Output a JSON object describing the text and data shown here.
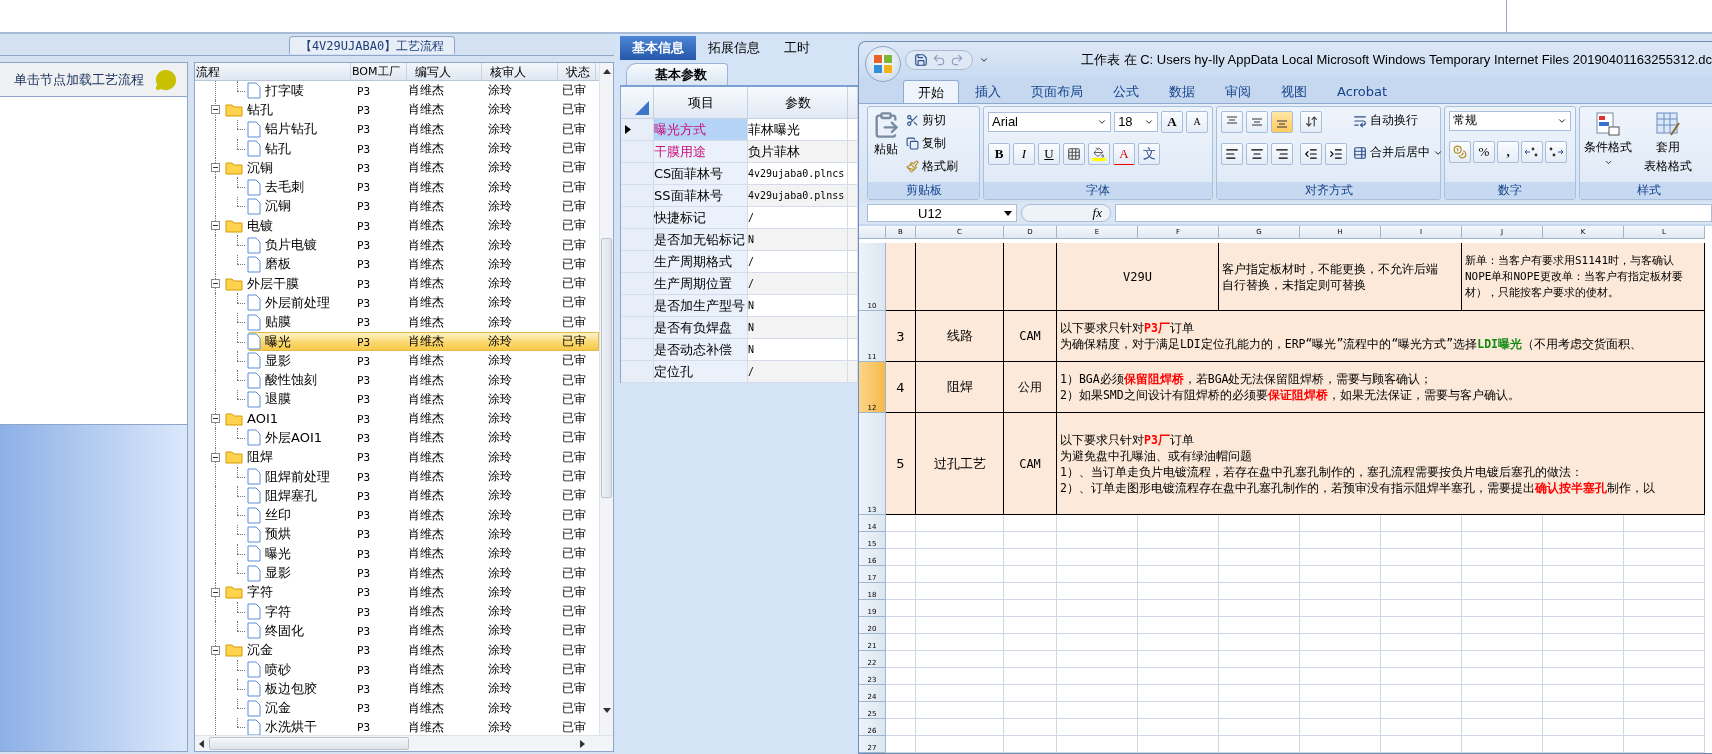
{
  "process_panel": {
    "title": "【4V29UJABA0】工艺流程",
    "hint": "单击节点加载工艺流程"
  },
  "tree": {
    "columns": [
      "流程",
      "BOM工厂",
      "编写人",
      "核审人",
      "状态"
    ],
    "nodes": [
      {
        "kind": "step",
        "name": "打字唛",
        "bom": "P3",
        "writer": "肖维杰",
        "reviewer": "涂玲",
        "status": "已审",
        "selected": false
      },
      {
        "kind": "group",
        "name": "钻孔",
        "bom": "P3",
        "writer": "肖维杰",
        "reviewer": "涂玲",
        "status": "已审",
        "selected": false,
        "expanded": true,
        "children": [
          {
            "kind": "step",
            "name": "铝片钻孔",
            "bom": "P3",
            "writer": "肖维杰",
            "reviewer": "涂玲",
            "status": "已审",
            "selected": false
          },
          {
            "kind": "step",
            "name": "钻孔",
            "bom": "P3",
            "writer": "肖维杰",
            "reviewer": "涂玲",
            "status": "已审",
            "selected": false
          }
        ]
      },
      {
        "kind": "group",
        "name": "沉铜",
        "bom": "P3",
        "writer": "肖维杰",
        "reviewer": "涂玲",
        "status": "已审",
        "selected": false,
        "expanded": true,
        "children": [
          {
            "kind": "step",
            "name": "去毛刺",
            "bom": "P3",
            "writer": "肖维杰",
            "reviewer": "涂玲",
            "status": "已审",
            "selected": false
          },
          {
            "kind": "step",
            "name": "沉铜",
            "bom": "P3",
            "writer": "肖维杰",
            "reviewer": "涂玲",
            "status": "已审",
            "selected": false
          }
        ]
      },
      {
        "kind": "group",
        "name": "电镀",
        "bom": "P3",
        "writer": "肖维杰",
        "reviewer": "涂玲",
        "status": "已审",
        "selected": false,
        "expanded": true,
        "children": [
          {
            "kind": "step",
            "name": "负片电镀",
            "bom": "P3",
            "writer": "肖维杰",
            "reviewer": "涂玲",
            "status": "已审",
            "selected": false
          },
          {
            "kind": "step",
            "name": "磨板",
            "bom": "P3",
            "writer": "肖维杰",
            "reviewer": "涂玲",
            "status": "已审",
            "selected": false
          }
        ]
      },
      {
        "kind": "group",
        "name": "外层干膜",
        "bom": "P3",
        "writer": "肖维杰",
        "reviewer": "涂玲",
        "status": "已审",
        "selected": false,
        "expanded": true,
        "children": [
          {
            "kind": "step",
            "name": "外层前处理",
            "bom": "P3",
            "writer": "肖维杰",
            "reviewer": "涂玲",
            "status": "已审",
            "selected": false
          },
          {
            "kind": "step",
            "name": "贴膜",
            "bom": "P3",
            "writer": "肖维杰",
            "reviewer": "涂玲",
            "status": "已审",
            "selected": false
          },
          {
            "kind": "step",
            "name": "曝光",
            "bom": "P3",
            "writer": "肖维杰",
            "reviewer": "涂玲",
            "status": "已审",
            "selected": true
          },
          {
            "kind": "step",
            "name": "显影",
            "bom": "P3",
            "writer": "肖维杰",
            "reviewer": "涂玲",
            "status": "已审",
            "selected": false
          },
          {
            "kind": "step",
            "name": "酸性蚀刻",
            "bom": "P3",
            "writer": "肖维杰",
            "reviewer": "涂玲",
            "status": "已审",
            "selected": false
          },
          {
            "kind": "step",
            "name": "退膜",
            "bom": "P3",
            "writer": "肖维杰",
            "reviewer": "涂玲",
            "status": "已审",
            "selected": false
          }
        ]
      },
      {
        "kind": "group",
        "name": "AOI1",
        "bom": "P3",
        "writer": "肖维杰",
        "reviewer": "涂玲",
        "status": "已审",
        "selected": false,
        "expanded": true,
        "children": [
          {
            "kind": "step",
            "name": "外层AOI1",
            "bom": "P3",
            "writer": "肖维杰",
            "reviewer": "涂玲",
            "status": "已审",
            "selected": false
          }
        ]
      },
      {
        "kind": "group",
        "name": "阻焊",
        "bom": "P3",
        "writer": "肖维杰",
        "reviewer": "涂玲",
        "status": "已审",
        "selected": false,
        "expanded": true,
        "children": [
          {
            "kind": "step",
            "name": "阻焊前处理",
            "bom": "P3",
            "writer": "肖维杰",
            "reviewer": "涂玲",
            "status": "已审",
            "selected": false
          },
          {
            "kind": "step",
            "name": "阻焊塞孔",
            "bom": "P3",
            "writer": "肖维杰",
            "reviewer": "涂玲",
            "status": "已审",
            "selected": false
          },
          {
            "kind": "step",
            "name": "丝印",
            "bom": "P3",
            "writer": "肖维杰",
            "reviewer": "涂玲",
            "status": "已审",
            "selected": false
          },
          {
            "kind": "step",
            "name": "预烘",
            "bom": "P3",
            "writer": "肖维杰",
            "reviewer": "涂玲",
            "status": "已审",
            "selected": false
          },
          {
            "kind": "step",
            "name": "曝光",
            "bom": "P3",
            "writer": "肖维杰",
            "reviewer": "涂玲",
            "status": "已审",
            "selected": false
          },
          {
            "kind": "step",
            "name": "显影",
            "bom": "P3",
            "writer": "肖维杰",
            "reviewer": "涂玲",
            "status": "已审",
            "selected": false
          }
        ]
      },
      {
        "kind": "group",
        "name": "字符",
        "bom": "P3",
        "writer": "肖维杰",
        "reviewer": "涂玲",
        "status": "已审",
        "selected": false,
        "expanded": true,
        "children": [
          {
            "kind": "step",
            "name": "字符",
            "bom": "P3",
            "writer": "肖维杰",
            "reviewer": "涂玲",
            "status": "已审",
            "selected": false
          },
          {
            "kind": "step",
            "name": "终固化",
            "bom": "P3",
            "writer": "肖维杰",
            "reviewer": "涂玲",
            "status": "已审",
            "selected": false
          }
        ]
      },
      {
        "kind": "group",
        "name": "沉金",
        "bom": "P3",
        "writer": "肖维杰",
        "reviewer": "涂玲",
        "status": "已审",
        "selected": false,
        "expanded": true,
        "children": [
          {
            "kind": "step",
            "name": "喷砂",
            "bom": "P3",
            "writer": "肖维杰",
            "reviewer": "涂玲",
            "status": "已审",
            "selected": false
          },
          {
            "kind": "step",
            "name": "板边包胶",
            "bom": "P3",
            "writer": "肖维杰",
            "reviewer": "涂玲",
            "status": "已审",
            "selected": false
          },
          {
            "kind": "step",
            "name": "沉金",
            "bom": "P3",
            "writer": "肖维杰",
            "reviewer": "涂玲",
            "status": "已审",
            "selected": false
          },
          {
            "kind": "step",
            "name": "水洗烘干",
            "bom": "P3",
            "writer": "肖维杰",
            "reviewer": "涂玲",
            "status": "已审",
            "selected": false
          }
        ]
      }
    ]
  },
  "info_panel": {
    "tabs": [
      {
        "label": "基本信息",
        "selected": true
      },
      {
        "label": "拓展信息",
        "selected": false
      },
      {
        "label": "工时",
        "selected": false
      }
    ],
    "subtab": "基本参数",
    "columns": [
      "项目",
      "参数"
    ],
    "rows": [
      {
        "label": "曝光方式",
        "value": "菲林曝光",
        "flagged": true,
        "selected": true
      },
      {
        "label": "干膜用途",
        "value": "负片菲林",
        "flagged": true,
        "selected": false
      },
      {
        "label": "CS面菲林号",
        "value": "4v29ujaba0.plncs",
        "flagged": false,
        "selected": false
      },
      {
        "label": "SS面菲林号",
        "value": "4v29ujaba0.plnss",
        "flagged": false,
        "selected": false
      },
      {
        "label": "快捷标记",
        "value": "/",
        "flagged": false,
        "selected": false
      },
      {
        "label": "是否加无铅标记",
        "value": "N",
        "flagged": false,
        "selected": false
      },
      {
        "label": "生产周期格式",
        "value": "/",
        "flagged": false,
        "selected": false
      },
      {
        "label": "生产周期位置",
        "value": "/",
        "flagged": false,
        "selected": false
      },
      {
        "label": "是否加生产型号",
        "value": "N",
        "flagged": false,
        "selected": false
      },
      {
        "label": "是否有负焊盘",
        "value": "N",
        "flagged": false,
        "selected": false
      },
      {
        "label": "是否动态补偿",
        "value": "N",
        "flagged": false,
        "selected": false
      },
      {
        "label": "定位孔",
        "value": "/",
        "flagged": false,
        "selected": false
      }
    ]
  },
  "excel": {
    "title": "工作表 在 C: Users hy-lly AppData Local Microsoft Windows Temporary Internet Files 20190401163255312.dc",
    "tabs": [
      {
        "label": "开始",
        "selected": true
      },
      {
        "label": "插入",
        "selected": false
      },
      {
        "label": "页面布局",
        "selected": false
      },
      {
        "label": "公式",
        "selected": false
      },
      {
        "label": "数据",
        "selected": false
      },
      {
        "label": "审阅",
        "selected": false
      },
      {
        "label": "视图",
        "selected": false
      },
      {
        "label": "Acrobat",
        "selected": false
      }
    ],
    "clipboard": {
      "paste": "粘贴",
      "cut": "剪切",
      "copy": "复制",
      "painter": "格式刷",
      "title": "剪贴板"
    },
    "font": {
      "name": "Arial",
      "size": "18",
      "grow": "A",
      "shrink": "A",
      "bold": "B",
      "italic": "I",
      "underline": "U",
      "color_letter": "A",
      "phonetic": "文",
      "title": "字体"
    },
    "alignment": {
      "vertical": [
        {
          "selected": false
        },
        {
          "selected": false
        },
        {
          "selected": true
        }
      ],
      "wrap": "自动换行",
      "merge": "合并后居中",
      "title": "对齐方式"
    },
    "number": {
      "format": "常规",
      "percent": "%",
      "comma": ",",
      "title": "数字"
    },
    "styles": {
      "conditional": "条件格式",
      "table": [
        "套用",
        "表格格式"
      ],
      "title": "样式"
    },
    "name_box": "U12",
    "fx": "fx",
    "columns": [
      "B",
      "C",
      "D",
      "E",
      "F",
      "G",
      "H",
      "I",
      "J",
      "K",
      "L"
    ],
    "rows": [
      {
        "kind": "spec",
        "header": "10",
        "selected": false,
        "code": "V29U",
        "note": [
          "客户指定板材时，不能更换，不允许后端",
          "自行替换，未指定则可替换"
        ],
        "detail": [
          "新单：当客户有要求用S1141时，与客确认",
          "NOPE单和NOPE更改单：当客户有指定板材要",
          "材），只能按客户要求的使材。"
        ]
      },
      {
        "kind": "requirement",
        "header": "11",
        "selected": false,
        "no": "3",
        "process": "线路",
        "dept": "CAM",
        "lines": [
          [
            {
              "text": "以下要求只针对",
              "kind": "plain"
            },
            {
              "text": "P3厂",
              "kind": "alert"
            },
            {
              "text": "订单",
              "kind": "plain"
            }
          ],
          [
            {
              "text": "为确保精度，对于满足LDI定位孔能力的，ERP“曝光”流程中的“曝光方式”选择",
              "kind": "plain"
            },
            {
              "text": "LDI曝光",
              "kind": "ok"
            },
            {
              "text": "（不用考虑交货面积、",
              "kind": "plain"
            }
          ]
        ]
      },
      {
        "kind": "requirement",
        "header": "12",
        "selected": true,
        "no": "4",
        "process": "阻焊",
        "dept": "公用",
        "lines": [
          [
            {
              "text": "1）BGA必须",
              "kind": "plain"
            },
            {
              "text": "保留阻焊桥",
              "kind": "alert"
            },
            {
              "text": "，若BGA处无法保留阻焊桥，需要与顾客确认；",
              "kind": "plain"
            }
          ],
          [
            {
              "text": "2）如果SMD之间设计有阻焊桥的必须要",
              "kind": "plain"
            },
            {
              "text": "保证阻焊桥",
              "kind": "alert"
            },
            {
              "text": "，如果无法保证，需要与客户确认。",
              "kind": "plain"
            }
          ]
        ]
      },
      {
        "kind": "requirement",
        "header": "13",
        "selected": false,
        "no": "5",
        "process": "过孔工艺",
        "dept": "CAM",
        "lines": [
          [
            {
              "text": "以下要求只针对",
              "kind": "plain"
            },
            {
              "text": "P3厂",
              "kind": "alert"
            },
            {
              "text": "订单",
              "kind": "plain"
            }
          ],
          [
            {
              "text": "为避免盘中孔曝油、或有绿油帽问题",
              "kind": "plain"
            }
          ],
          [
            {
              "text": "1）、当订单走负片电镀流程，若存在盘中孔塞孔制作的，塞孔流程需要按负片电镀后塞孔的做法：",
              "kind": "plain"
            }
          ],
          [
            {
              "text": "2）、订单走图形电镀流程存在盘中孔塞孔制作的，若预审没有指示阻焊半塞孔，需要提出",
              "kind": "plain"
            },
            {
              "text": "确认按半塞孔",
              "kind": "alert"
            },
            {
              "text": "制作，以",
              "kind": "plain"
            }
          ]
        ]
      },
      {
        "kind": "blank",
        "header": "14",
        "selected": false
      },
      {
        "kind": "blank",
        "header": "15",
        "selected": false
      },
      {
        "kind": "blank",
        "header": "16",
        "selected": false
      },
      {
        "kind": "blank",
        "header": "17",
        "selected": false
      },
      {
        "kind": "blank",
        "header": "18",
        "selected": false
      },
      {
        "kind": "blank",
        "header": "19",
        "selected": false
      },
      {
        "kind": "blank",
        "header": "20",
        "selected": false
      },
      {
        "kind": "blank",
        "header": "21",
        "selected": false
      },
      {
        "kind": "blank",
        "header": "22",
        "selected": false
      },
      {
        "kind": "blank",
        "header": "23",
        "selected": false
      },
      {
        "kind": "blank",
        "header": "24",
        "selected": false
      },
      {
        "kind": "blank",
        "header": "25",
        "selected": false
      },
      {
        "kind": "blank",
        "header": "26",
        "selected": false
      },
      {
        "kind": "blank",
        "header": "27",
        "selected": false
      }
    ]
  }
}
